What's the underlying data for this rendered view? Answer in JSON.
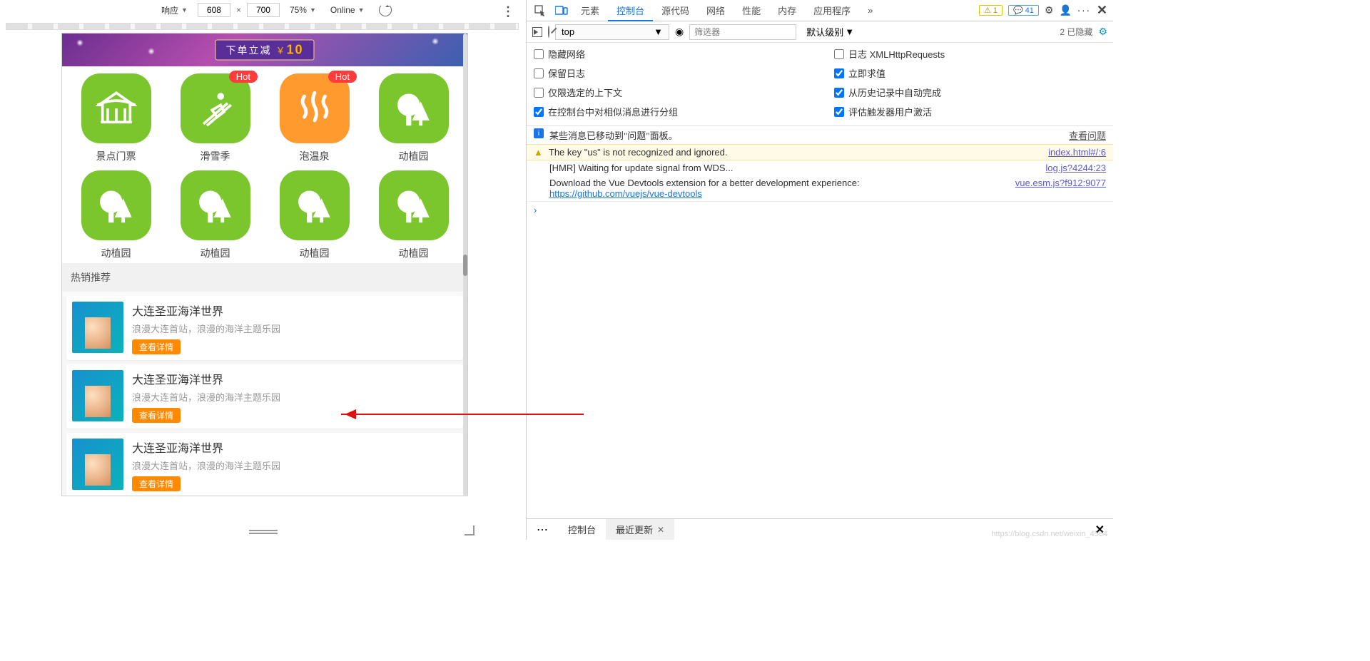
{
  "deviceToolbar": {
    "responsiveLabel": "响应",
    "width": "608",
    "height": "700",
    "zoom": "75%",
    "throttle": "Online"
  },
  "banner": {
    "text": "下单立减",
    "currency": "￥",
    "amount": "10"
  },
  "categories": [
    {
      "label": "景点门票",
      "color": "green",
      "icon": "pavilion",
      "hot": false
    },
    {
      "label": "滑雪季",
      "color": "green",
      "icon": "ski",
      "hot": true,
      "hotText": "Hot"
    },
    {
      "label": "泡温泉",
      "color": "orange",
      "icon": "hotspring",
      "hot": true,
      "hotText": "Hot"
    },
    {
      "label": "动植园",
      "color": "green",
      "icon": "tree",
      "hot": false
    },
    {
      "label": "动植园",
      "color": "green",
      "icon": "tree",
      "hot": false
    },
    {
      "label": "动植园",
      "color": "green",
      "icon": "tree",
      "hot": false
    },
    {
      "label": "动植园",
      "color": "green",
      "icon": "tree",
      "hot": false
    },
    {
      "label": "动植园",
      "color": "green",
      "icon": "tree",
      "hot": false
    }
  ],
  "sectionTitle": "热销推荐",
  "hotItems": [
    {
      "title": "大连圣亚海洋世界",
      "desc": "浪漫大连首站，浪漫的海洋主题乐园",
      "btn": "查看详情"
    },
    {
      "title": "大连圣亚海洋世界",
      "desc": "浪漫大连首站，浪漫的海洋主题乐园",
      "btn": "查看详情"
    },
    {
      "title": "大连圣亚海洋世界",
      "desc": "浪漫大连首站，浪漫的海洋主题乐园",
      "btn": "查看详情"
    }
  ],
  "devtools": {
    "tabs": {
      "elements": "元素",
      "console": "控制台",
      "sources": "源代码",
      "network": "网络",
      "performance": "性能",
      "memory": "内存",
      "application": "应用程序",
      "more": "»"
    },
    "warnCount": "1",
    "infoCount": "41",
    "context": "top",
    "filterPlaceholder": "筛选器",
    "level": "默认级别",
    "hidden": "2 已隐藏",
    "options": {
      "hideNetwork": "隐藏网络",
      "logXhr": "日志 XMLHttpRequests",
      "preserveLog": "保留日志",
      "eagerEval": "立即求值",
      "selectedCtxOnly": "仅限选定的上下文",
      "autocompleteHist": "从历史记录中自动完成",
      "groupSimilar": "在控制台中对相似消息进行分组",
      "evalUserAct": "评估触发器用户激活"
    },
    "messages": {
      "issuesInfo": "某些消息已移动到\"问题\"面板。",
      "issuesLink": "查看问题",
      "warnText": "The key \"us\" is not recognized and ignored.",
      "warnSrc": "index.html#/:6",
      "hmrText": "[HMR] Waiting for update signal from WDS...",
      "hmrSrc": "log.js?4244:23",
      "vueText": "Download the Vue Devtools extension for a better development experience: ",
      "vueLink": "https://github.com/vuejs/vue-devtools",
      "vueSrc": "vue.esm.js?f912:9077"
    },
    "drawer": {
      "console": "控制台",
      "recent": "最近更新"
    }
  },
  "watermark": "https://blog.csdn.net/weixin_4564"
}
